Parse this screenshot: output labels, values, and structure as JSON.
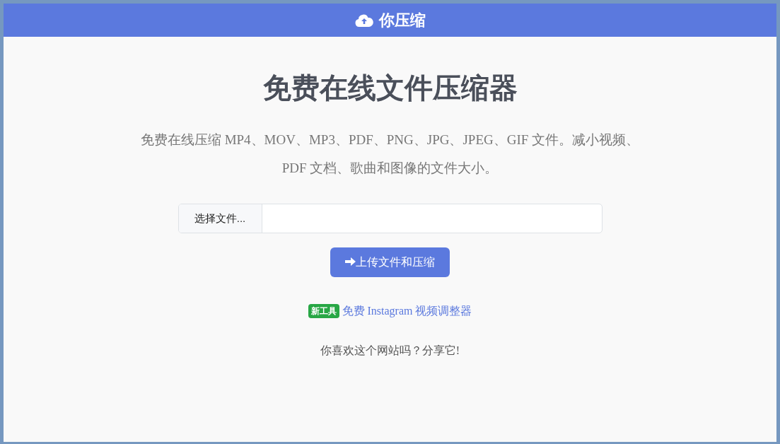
{
  "brand": {
    "title": "你压缩"
  },
  "heading": "免费在线文件压缩器",
  "description": "免费在线压缩 MP4、MOV、MP3、PDF、PNG、JPG、JPEG、GIF 文件。减小视频、PDF 文档、歌曲和图像的文件大小。",
  "file_input": {
    "button_label": "选择文件..."
  },
  "upload_button": {
    "label": "上传文件和压缩"
  },
  "new_tool": {
    "badge": "新工具",
    "link": "免费 Instagram 视频调整器"
  },
  "share_prompt": "你喜欢这个网站吗？分享它!"
}
